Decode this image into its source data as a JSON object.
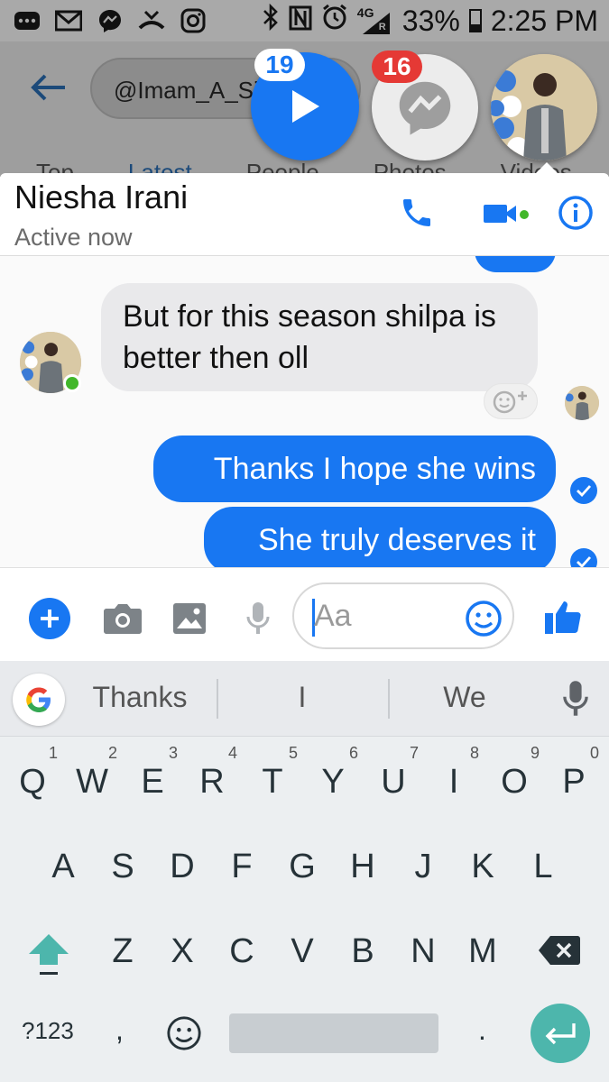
{
  "status_bar": {
    "battery": "33%",
    "time": "2:25 PM",
    "network": "4G",
    "network_sub": "R",
    "left_icons": [
      "more-icon",
      "gmail-icon",
      "messenger-icon",
      "missed-call-icon",
      "instagram-icon"
    ],
    "right_icons": [
      "bluetooth-icon",
      "nfc-icon",
      "alarm-icon",
      "signal-icon",
      "battery-icon"
    ]
  },
  "background_app": {
    "search_text": "@Imam_A_Si",
    "tabs": [
      "Top",
      "Latest",
      "People",
      "Photos",
      "Videos"
    ]
  },
  "chat_heads": {
    "video_badge": "19",
    "messenger_badge": "16"
  },
  "conversation": {
    "contact_name": "Niesha Irani",
    "status": "Active now"
  },
  "messages": [
    {
      "direction": "incoming",
      "text": "But for this season shilpa is better then oll"
    },
    {
      "direction": "outgoing",
      "text": "Thanks I hope she wins"
    },
    {
      "direction": "outgoing",
      "text": "She truly deserves it"
    }
  ],
  "composer": {
    "placeholder": "Aa"
  },
  "keyboard": {
    "suggestions": [
      "Thanks",
      "I",
      "We"
    ],
    "row1": [
      {
        "key": "Q",
        "alt": "1"
      },
      {
        "key": "W",
        "alt": "2"
      },
      {
        "key": "E",
        "alt": "3"
      },
      {
        "key": "R",
        "alt": "4"
      },
      {
        "key": "T",
        "alt": "5"
      },
      {
        "key": "Y",
        "alt": "6"
      },
      {
        "key": "U",
        "alt": "7"
      },
      {
        "key": "I",
        "alt": "8"
      },
      {
        "key": "O",
        "alt": "9"
      },
      {
        "key": "P",
        "alt": "0"
      }
    ],
    "row2": [
      "A",
      "S",
      "D",
      "F",
      "G",
      "H",
      "J",
      "K",
      "L"
    ],
    "row3": [
      "Z",
      "X",
      "C",
      "V",
      "B",
      "N",
      "M"
    ],
    "symbols_label": "?123",
    "comma": ",",
    "period": "."
  },
  "colors": {
    "messenger_blue": "#1877f2",
    "online_green": "#42b72a",
    "badge_red": "#e53935",
    "enter_teal": "#4db6ac"
  }
}
